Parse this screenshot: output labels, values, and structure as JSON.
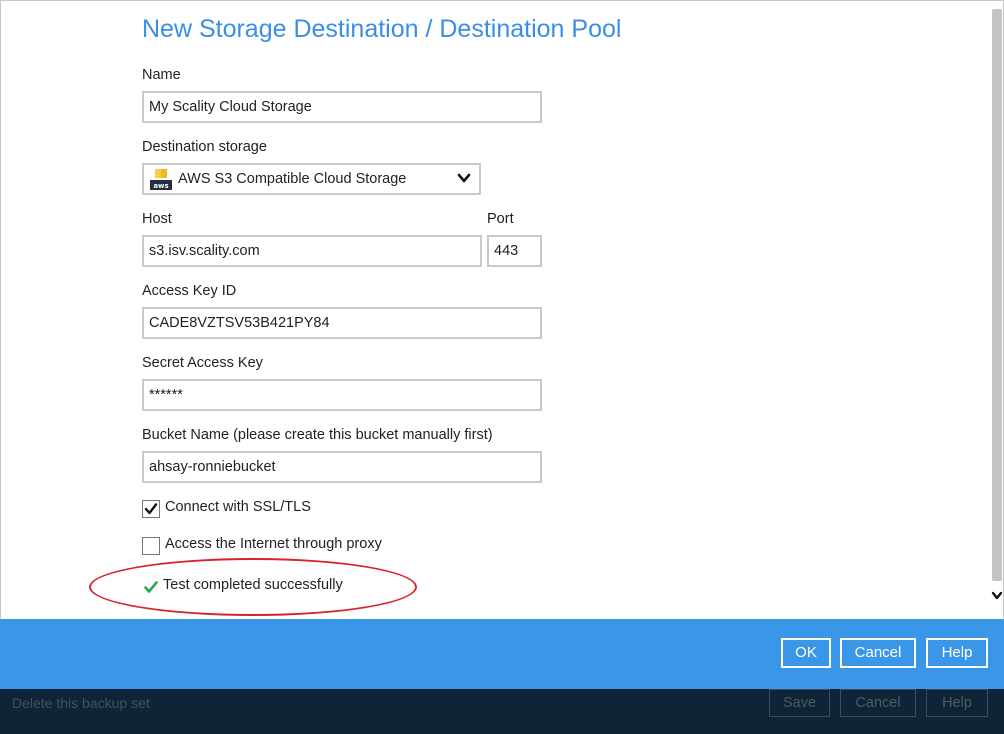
{
  "dialog": {
    "title": "New Storage Destination / Destination Pool",
    "name": {
      "label": "Name",
      "value": "My Scality Cloud Storage"
    },
    "destination_storage": {
      "label": "Destination storage",
      "selected": "AWS S3 Compatible Cloud Storage",
      "icon": "aws-logo-icon"
    },
    "host": {
      "label": "Host",
      "value": "s3.isv.scality.com"
    },
    "port": {
      "label": "Port",
      "value": "443"
    },
    "access_key_id": {
      "label": "Access Key ID",
      "value": "CADE8VZTSV53B421PY84"
    },
    "secret_access_key": {
      "label": "Secret Access Key",
      "value": "******"
    },
    "bucket_name": {
      "label": "Bucket Name (please create this bucket manually first)",
      "value": "ahsay-ronniebucket"
    },
    "ssl": {
      "label": "Connect with SSL/TLS",
      "checked": true
    },
    "proxy": {
      "label": "Access the Internet through proxy",
      "checked": false
    },
    "test_result": {
      "text": "Test completed successfully",
      "color": "#2aa84a"
    },
    "highlight_color": "#d8232a"
  },
  "footer": {
    "ok_label": "OK",
    "cancel_label": "Cancel",
    "help_label": "Help",
    "color": "#3a97e8"
  },
  "background": {
    "delete_text": "Delete this backup set",
    "save_label": "Save",
    "cancel_label": "Cancel",
    "help_label": "Help"
  }
}
